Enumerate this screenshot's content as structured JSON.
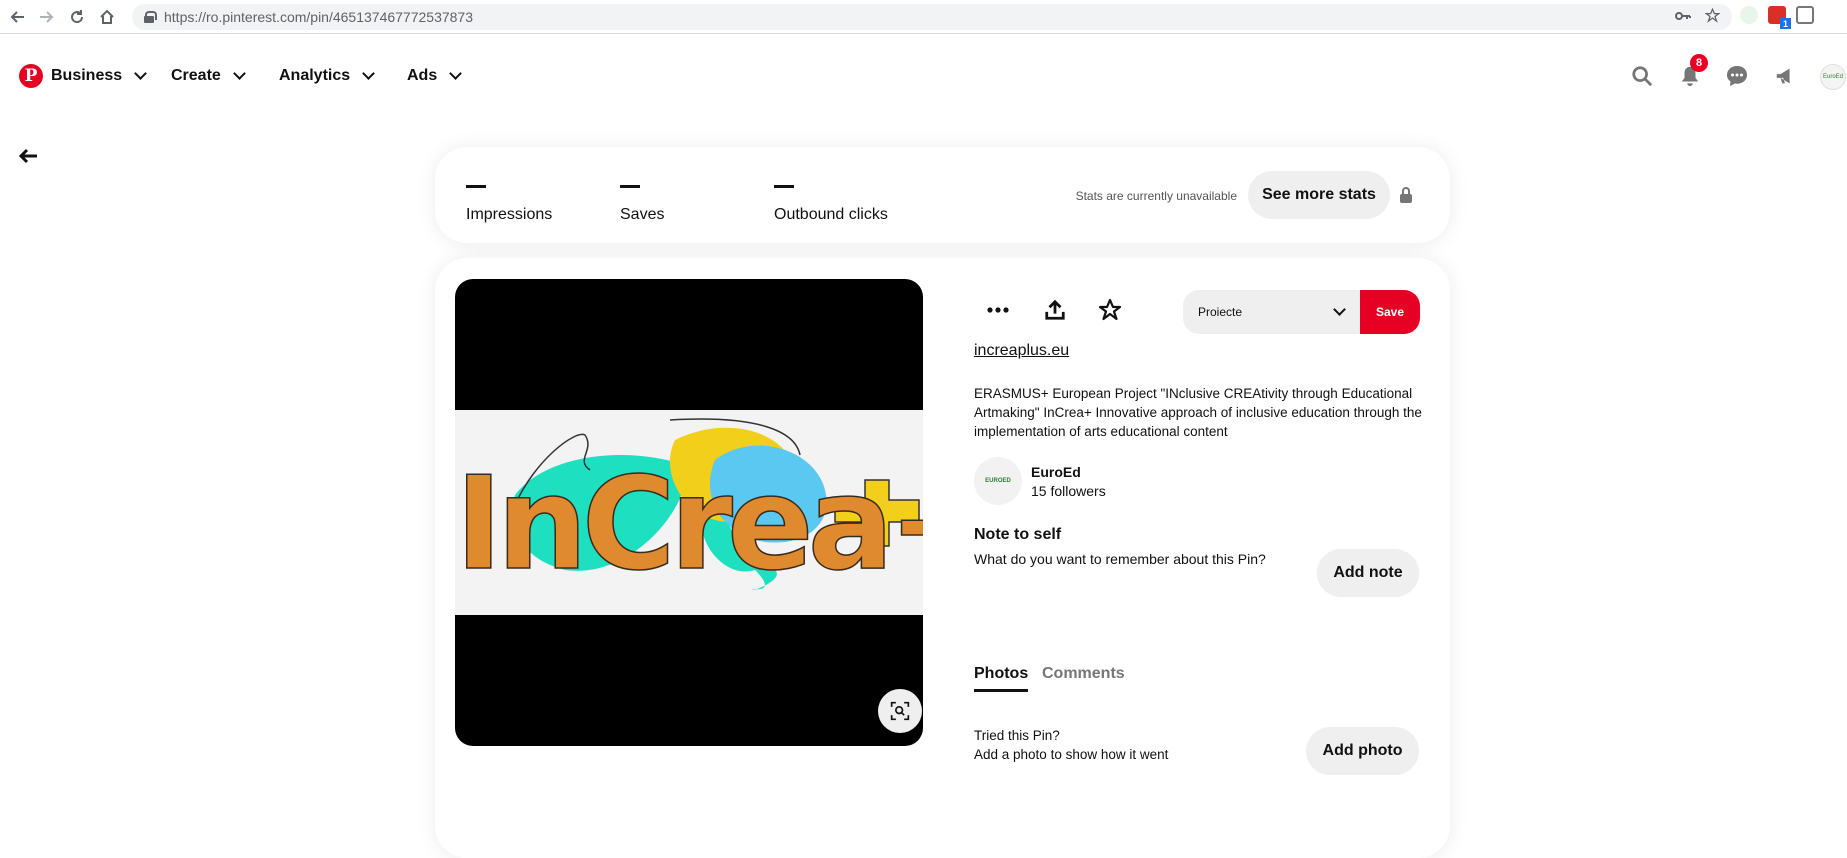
{
  "browser": {
    "url": "https://ro.pinterest.com/pin/465137467772537873",
    "ext_badge": "1"
  },
  "header": {
    "nav": [
      {
        "label": "Business"
      },
      {
        "label": "Create"
      },
      {
        "label": "Analytics"
      },
      {
        "label": "Ads"
      }
    ],
    "notifications_count": "8",
    "avatar_text": "EuroEd"
  },
  "stats": {
    "items": [
      {
        "label": "Impressions"
      },
      {
        "label": "Saves"
      },
      {
        "label": "Outbound clicks"
      }
    ],
    "unavailable_text": "Stats are currently unavailable",
    "see_more_label": "See more stats"
  },
  "pin": {
    "image_logo_text": "InCrea+",
    "board_select": "Proiecte",
    "save_label": "Save",
    "link": "increaplus.eu",
    "description": "ERASMUS+ European Project \"INclusive CREAtivity through Educational Artmaking\" InCrea+ Innovative approach of inclusive education through the implementation of arts educational content",
    "owner": {
      "avatar_text": "EUROED",
      "name": "EuroEd",
      "followers": "15 followers"
    },
    "note": {
      "title": "Note to self",
      "question": "What do you want to remember about this Pin?",
      "button": "Add note"
    },
    "tabs": [
      {
        "label": "Photos",
        "active": true
      },
      {
        "label": "Comments",
        "active": false
      }
    ],
    "tried": {
      "line1": "Tried this Pin?",
      "line2": "Add a photo to show how it went",
      "button": "Add photo"
    }
  },
  "colors": {
    "brand": "#e60023",
    "button_gray": "#efefef"
  }
}
